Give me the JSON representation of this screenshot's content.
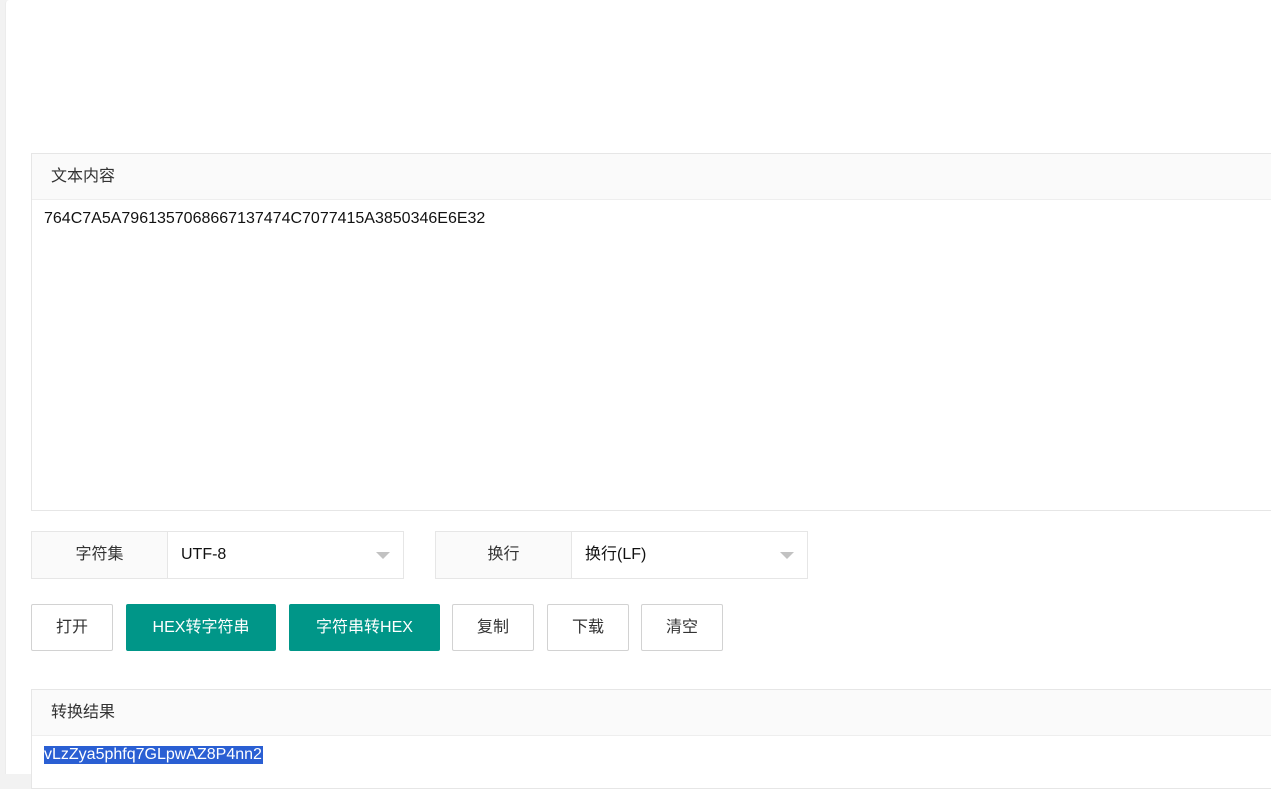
{
  "input": {
    "header": "文本内容",
    "value": "764C7A5A7961357068667137474C7077415A3850346E6E32"
  },
  "charset": {
    "label": "字符集",
    "value": "UTF-8"
  },
  "newline": {
    "label": "换行",
    "value": "换行(LF)"
  },
  "buttons": {
    "open": "打开",
    "hex_to_string": "HEX转字符串",
    "string_to_hex": "字符串转HEX",
    "copy": "复制",
    "download": "下载",
    "clear": "清空"
  },
  "result": {
    "header": "转换结果",
    "value": "vLzZya5phfq7GLpwAZ8P4nn2"
  },
  "colors": {
    "primary": "#009688",
    "selection": "#2a5fd3"
  }
}
